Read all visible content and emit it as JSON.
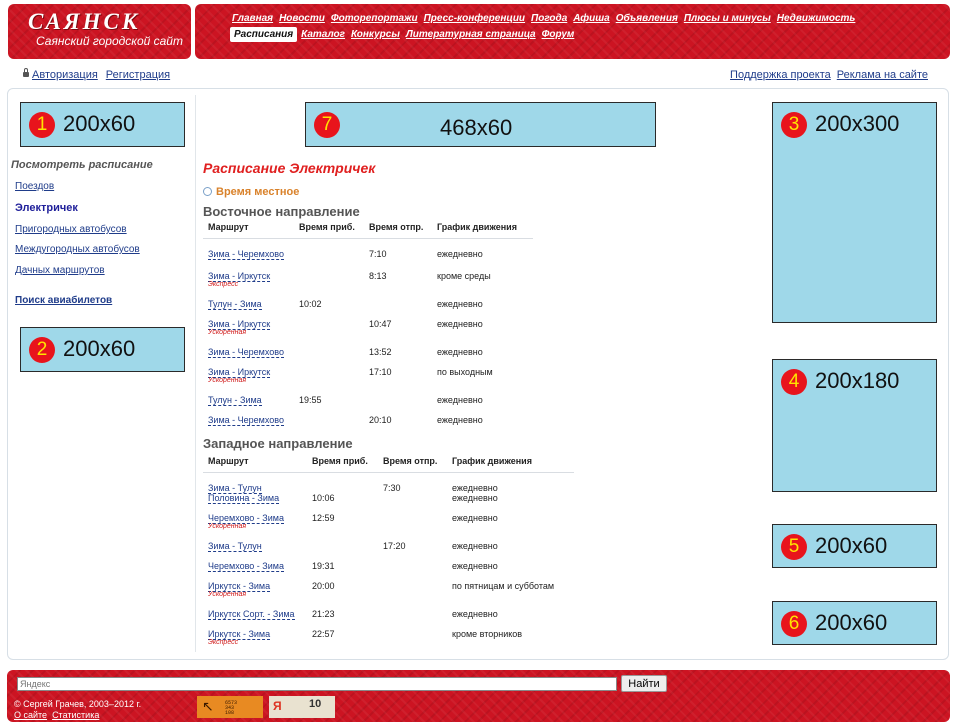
{
  "header": {
    "logo": "САЯНСК",
    "subtitle": "Саянский городской сайт",
    "nav_row1": [
      "Главная",
      "Новости",
      "Фоторепортажи",
      "Пресс-конференции",
      "Погода",
      "Афиша",
      "Объявления",
      "Плюсы и минусы",
      "Недвижимость"
    ],
    "nav_row2_active": "Расписания",
    "nav_row2": [
      "Каталог",
      "Конкурсы",
      "Литературная страница",
      "Форум"
    ]
  },
  "auth": {
    "login": "Авторизация",
    "register": "Регистрация",
    "support": "Поддержка проекта",
    "advertise": "Реклама на сайте"
  },
  "ads": [
    {
      "num": "1",
      "size": "200x60"
    },
    {
      "num": "2",
      "size": "200x60"
    },
    {
      "num": "3",
      "size": "200x300"
    },
    {
      "num": "4",
      "size": "200x180"
    },
    {
      "num": "5",
      "size": "200x60"
    },
    {
      "num": "6",
      "size": "200x60"
    },
    {
      "num": "7",
      "size": "468x60"
    }
  ],
  "sidebar": {
    "title": "Посмотреть расписание",
    "items": [
      "Поездов",
      "Электричек",
      "Пригородных автобусов",
      "Междугородных автобусов",
      "Дачных маршрутов"
    ],
    "flights": "Поиск авиабилетов"
  },
  "main": {
    "title": "Расписание Электричек",
    "time_note": "Время местное",
    "columns": [
      "Маршрут",
      "Время приб.",
      "Время отпр.",
      "График движения"
    ],
    "east": {
      "title": "Восточное направление",
      "rows": [
        {
          "route": "Зима - Черемхово",
          "type": "",
          "arr": "",
          "dep": "7:10",
          "sched": "ежедневно"
        },
        {
          "route": "Зима - Иркутск",
          "type": "Экспресс",
          "arr": "",
          "dep": "8:13",
          "sched": "кроме среды"
        },
        {
          "route": "Тулун - Зима",
          "type": "",
          "arr": "10:02",
          "dep": "",
          "sched": "ежедневно"
        },
        {
          "route": "Зима - Иркутск",
          "type": "Ускоренная",
          "arr": "",
          "dep": "10:47",
          "sched": "ежедневно"
        },
        {
          "route": "Зима - Черемхово",
          "type": "",
          "arr": "",
          "dep": "13:52",
          "sched": "ежедневно"
        },
        {
          "route": "Зима - Иркутск",
          "type": "Ускоренная",
          "arr": "",
          "dep": "17:10",
          "sched": "по выходным"
        },
        {
          "route": "Тулун - Зима",
          "type": "",
          "arr": "19:55",
          "dep": "",
          "sched": "ежедневно"
        },
        {
          "route": "Зима - Черемхово",
          "type": "",
          "arr": "",
          "dep": "20:10",
          "sched": "ежедневно"
        }
      ]
    },
    "west": {
      "title": "Западное направление",
      "rows": [
        {
          "route": "Зима - Тулун",
          "type": "",
          "arr": "",
          "dep": "7:30",
          "sched": "ежедневно"
        },
        {
          "route": "Половина - Зима",
          "type": "",
          "arr": "10:06",
          "dep": "",
          "sched": "ежедневно"
        },
        {
          "route": "Черемхово - Зима",
          "type": "Ускоренная",
          "arr": "12:59",
          "dep": "",
          "sched": "ежедневно"
        },
        {
          "route": "Зима - Тулун",
          "type": "",
          "arr": "",
          "dep": "17:20",
          "sched": "ежедневно"
        },
        {
          "route": "Черемхово - Зима",
          "type": "",
          "arr": "19:31",
          "dep": "",
          "sched": "ежедневно"
        },
        {
          "route": "Иркутск - Зима",
          "type": "Ускоренная",
          "arr": "20:00",
          "dep": "",
          "sched": "по пятницам и субботам"
        },
        {
          "route": "Иркутск Сорт. - Зима",
          "type": "",
          "arr": "21:23",
          "dep": "",
          "sched": "ежедневно"
        },
        {
          "route": "Иркутск - Зима",
          "type": "Экспресс",
          "arr": "22:57",
          "dep": "",
          "sched": "кроме вторников"
        }
      ]
    }
  },
  "footer": {
    "search_placeholder": "Яндекс",
    "search_button": "Найти",
    "copyright": "© Сергей Грачев, 2003–2012 г.",
    "about": "О сайте",
    "stats": "Статистика",
    "counter1_digits": [
      "6573",
      "343",
      "108"
    ],
    "counter2_letter": "Я",
    "counter2_num": "10"
  },
  "colors": {
    "brand_red": "#cc1422",
    "ad_fill": "#9fd8e9",
    "link": "#1f3c8a",
    "title_red": "#e02020",
    "note_orange": "#d9822b"
  }
}
